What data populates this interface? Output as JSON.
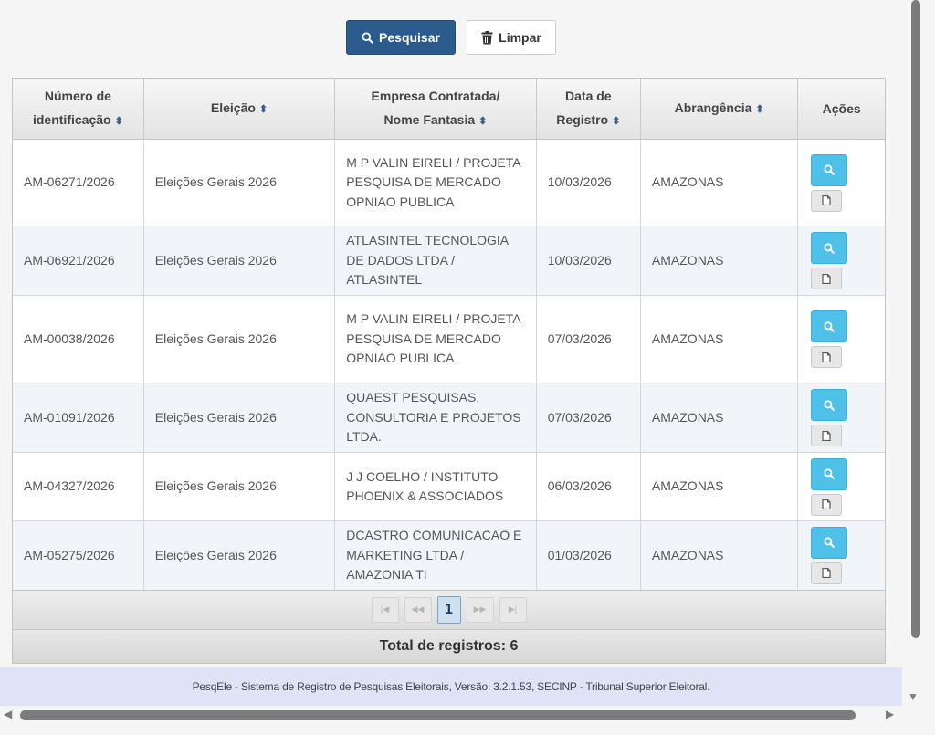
{
  "toolbar": {
    "search_label": "Pesquisar",
    "clear_label": "Limpar"
  },
  "table": {
    "headers": {
      "id_line1": "Número de",
      "id_line2": "identificação",
      "election": "Eleição",
      "company_line1": "Empresa Contratada/",
      "company_line2": "Nome Fantasia",
      "date_line1": "Data de",
      "date_line2": "Registro",
      "scope": "Abrangência",
      "actions": "Ações"
    },
    "rows": [
      {
        "id": "AM-06271/2026",
        "election": "Eleições Gerais 2026",
        "company": "M P VALIN EIRELI / PROJETA PESQUISA DE MERCADO OPNIAO PUBLICA",
        "date": "10/03/2026",
        "scope": "AMAZONAS"
      },
      {
        "id": "AM-06921/2026",
        "election": "Eleições Gerais 2026",
        "company": "ATLASINTEL TECNOLOGIA DE DADOS LTDA / ATLASINTEL",
        "date": "10/03/2026",
        "scope": "AMAZONAS"
      },
      {
        "id": "AM-00038/2026",
        "election": "Eleições Gerais 2026",
        "company": "M P VALIN EIRELI / PROJETA PESQUISA DE MERCADO OPNIAO PUBLICA",
        "date": "07/03/2026",
        "scope": "AMAZONAS"
      },
      {
        "id": "AM-01091/2026",
        "election": "Eleições Gerais 2026",
        "company": "QUAEST PESQUISAS, CONSULTORIA E PROJETOS LTDA.",
        "date": "07/03/2026",
        "scope": "AMAZONAS"
      },
      {
        "id": "AM-04327/2026",
        "election": "Eleições Gerais 2026",
        "company": "J J COELHO / INSTITUTO PHOENIX & ASSOCIADOS",
        "date": "06/03/2026",
        "scope": "AMAZONAS"
      },
      {
        "id": "AM-05275/2026",
        "election": "Eleições Gerais 2026",
        "company": "DCASTRO COMUNICACAO E MARKETING LTDA / AMAZONIA TI",
        "date": "01/03/2026",
        "scope": "AMAZONAS"
      }
    ]
  },
  "pagination": {
    "current_page": "1",
    "total_label": "Total de registros: 6"
  },
  "footer": {
    "text": "PesqEle - Sistema de Registro de Pesquisas Eleitorais, Versão: 3.2.1.53, SECINP - Tribunal Superior Eleitoral."
  },
  "icons": {
    "search": "search-icon",
    "trash": "trash-icon",
    "sort": "sort-icon",
    "document": "document-icon"
  },
  "colors": {
    "primary": "#2b5b8d",
    "action_search": "#4fc0e8",
    "row_alt": "#f1f5fa",
    "footer_bg": "#dfe3f5"
  }
}
